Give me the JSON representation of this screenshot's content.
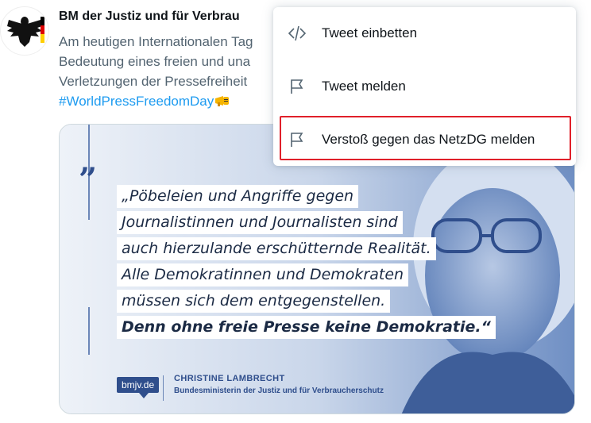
{
  "tweet": {
    "author": "BM der Justiz und für Verbrau",
    "text_lines": [
      "Am heutigen Internationalen Tag",
      "Bedeutung eines freien und una",
      "Verletzungen der Pressefreiheit"
    ],
    "hashtag": "#WorldPressFreedomDay",
    "avatar_icon": "federal-eagle-icon",
    "hashtag_emoji_icon": "megaphone-icon"
  },
  "image_card": {
    "quote_mark": "”",
    "quote_lines": [
      "„Pöbeleien und Angriffe gegen",
      "Journalistinnen und Journalisten sind",
      "auch hierzulande erschütternde Realität.",
      "Alle Demokratinnen und Demokraten",
      "müssen sich dem entgegenstellen.",
      "Denn ohne freie Presse keine Demokratie.“"
    ],
    "logo": "bmjv.de",
    "speaker_name": "CHRISTINE LAMBRECHT",
    "speaker_title": "Bundesministerin der Justiz und für Verbraucherschutz"
  },
  "menu": {
    "items": [
      {
        "label": "Tweet einbetten",
        "icon": "code-icon"
      },
      {
        "label": "Tweet melden",
        "icon": "flag-icon"
      },
      {
        "label": "Verstoß gegen das NetzDG melden",
        "icon": "flag-icon"
      }
    ],
    "highlight_color": "#e0202a"
  },
  "colors": {
    "hashtag": "#1d9bf0",
    "muted_text": "#536471",
    "brand_blue": "#2f4e8c"
  }
}
